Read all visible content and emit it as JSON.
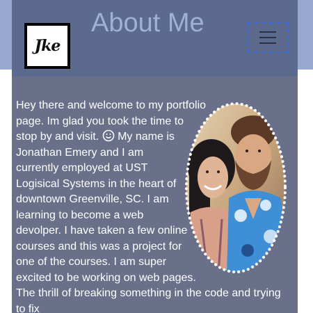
{
  "header": {
    "logo_text": "Jke",
    "title": "About Me",
    "menu_icon": "hamburger-menu-icon"
  },
  "colors": {
    "band": "#97a9d0",
    "header": "#5c6a8d",
    "content": "#6a708a",
    "title": "#9db0d6",
    "focus_outline": "#3f6bd6"
  },
  "main": {
    "photo_icon": "couple-portrait-photo",
    "bio_part1": "Hey there and welcome to my portfolio page. Im glad you took the time to stop by and visit.",
    "smiley_icon": "smiley-emoji-icon",
    "bio_part2": "My name is Jonathan Emery and I am currently employed at UST Logisical Systems in the heart of downtown Greenville, SC. I am learning to become a web devolper. I have taken a few online courses and this was a project for one of the courses. I am super excited to be working on web pages. The thrill of breaking something in the code and trying to fix"
  }
}
